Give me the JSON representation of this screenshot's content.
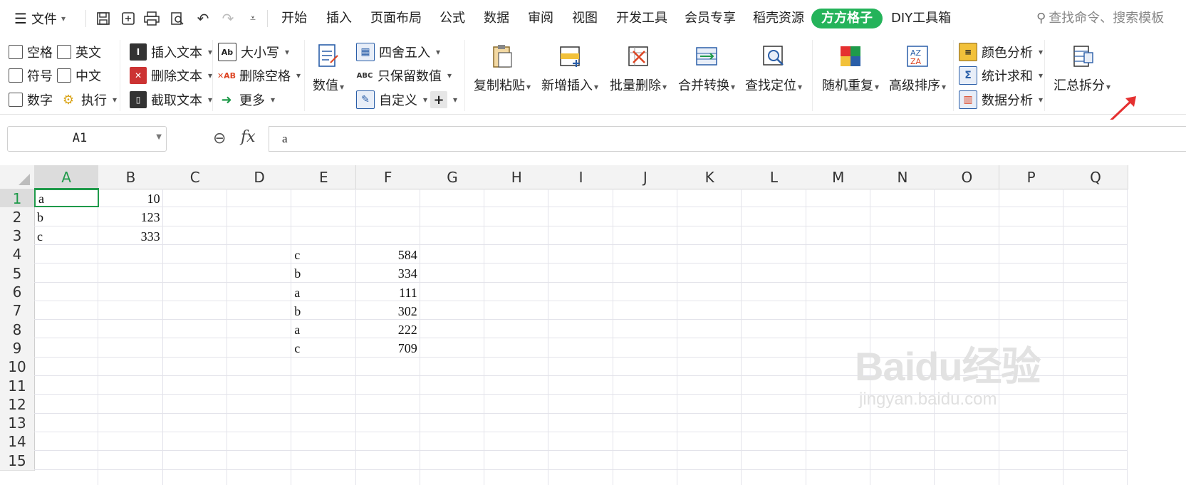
{
  "menu": {
    "file_label": "文件"
  },
  "quick_access": [
    "save-icon",
    "export-icon",
    "print-icon",
    "print-preview-icon",
    "undo-icon",
    "redo-icon",
    "customize-icon"
  ],
  "tabs": [
    {
      "label": "开始"
    },
    {
      "label": "插入"
    },
    {
      "label": "页面布局"
    },
    {
      "label": "公式"
    },
    {
      "label": "数据"
    },
    {
      "label": "审阅"
    },
    {
      "label": "视图"
    },
    {
      "label": "开发工具"
    },
    {
      "label": "会员专享"
    },
    {
      "label": "稻壳资源"
    },
    {
      "label": "方方格子",
      "active": true
    },
    {
      "label": "DIY工具箱"
    }
  ],
  "search": {
    "placeholder": "查找命令、搜索模板"
  },
  "ribbon": {
    "checkboxes": [
      "空格",
      "英文",
      "符号",
      "中文",
      "数字"
    ],
    "execute_label": "执行",
    "text_group": [
      "插入文本",
      "删除文本",
      "截取文本"
    ],
    "case_group": [
      "大小写",
      "删除空格",
      "更多"
    ],
    "number_label": "数值",
    "round_group": [
      "四舍五入",
      "只保留数值",
      "自定义"
    ],
    "big_buttons": [
      "复制粘贴",
      "新增插入",
      "批量删除",
      "合并转换",
      "查找定位",
      "随机重复",
      "高级排序"
    ],
    "analysis_group": [
      "颜色分析",
      "统计求和",
      "数据分析"
    ],
    "summary_split_label": "汇总拆分",
    "highlight_color": "#e53030",
    "accent_color": "#24b35a"
  },
  "formula_bar": {
    "cell_ref": "A1",
    "value": "a",
    "fx_label": "fx"
  },
  "sheet": {
    "columns": [
      "A",
      "B",
      "C",
      "D",
      "E",
      "F",
      "G",
      "H",
      "I",
      "J",
      "K",
      "L",
      "M",
      "N",
      "O",
      "P",
      "Q"
    ],
    "rows": [
      "1",
      "2",
      "3",
      "4",
      "5",
      "6",
      "7",
      "8",
      "9",
      "10",
      "11",
      "12",
      "13",
      "14",
      "15"
    ],
    "selected_cell": "A1",
    "cells": {
      "A1": "a",
      "B1": "10",
      "A2": "b",
      "B2": "123",
      "A3": "c",
      "B3": "333",
      "E4": "c",
      "F4": "584",
      "E5": "b",
      "F5": "334",
      "E6": "a",
      "F6": "111",
      "E7": "b",
      "F7": "302",
      "E8": "a",
      "F8": "222",
      "E9": "c",
      "F9": "709"
    }
  },
  "watermark": {
    "logo": "Baidu经验",
    "url": "jingyan.baidu.com"
  }
}
